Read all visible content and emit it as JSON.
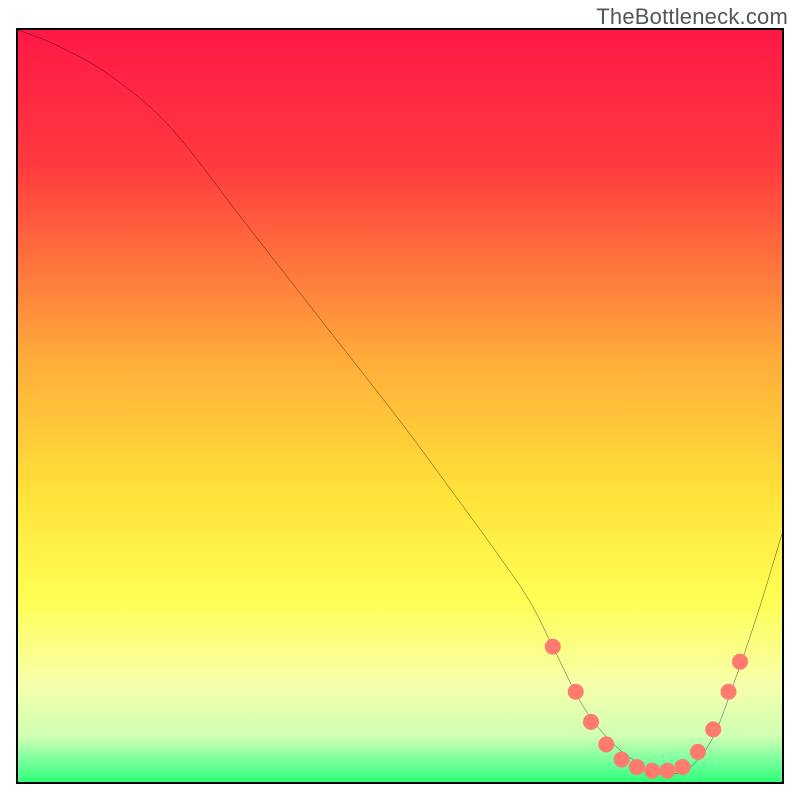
{
  "watermark": "TheBottleneck.com",
  "chart_data": {
    "type": "line",
    "title": "",
    "xlabel": "",
    "ylabel": "",
    "xlim": [
      0,
      100
    ],
    "ylim": [
      0,
      100
    ],
    "gradient_stops": [
      {
        "offset": 0,
        "color": "#ff1846"
      },
      {
        "offset": 18,
        "color": "#ff3a3f"
      },
      {
        "offset": 45,
        "color": "#ffb13a"
      },
      {
        "offset": 62,
        "color": "#ffe33a"
      },
      {
        "offset": 76,
        "color": "#ffff55"
      },
      {
        "offset": 87,
        "color": "#f6ffab"
      },
      {
        "offset": 94,
        "color": "#cfffb4"
      },
      {
        "offset": 97,
        "color": "#7dffa0"
      },
      {
        "offset": 100,
        "color": "#2dff78"
      }
    ],
    "series": [
      {
        "name": "curve",
        "color": "#000000",
        "x": [
          0,
          5,
          12,
          20,
          30,
          40,
          50,
          58,
          63,
          67,
          70,
          74,
          78,
          82,
          85,
          88,
          91,
          94,
          97,
          100
        ],
        "y": [
          100,
          98,
          94,
          87,
          74,
          61,
          48,
          37,
          30,
          24,
          18,
          10,
          5,
          2,
          1,
          2,
          6,
          14,
          23,
          33
        ]
      }
    ],
    "markers": {
      "name": "dots",
      "color": "#ff7b6f",
      "radius": 8,
      "points": [
        {
          "x": 70,
          "y": 18
        },
        {
          "x": 73,
          "y": 12
        },
        {
          "x": 75,
          "y": 8
        },
        {
          "x": 77,
          "y": 5
        },
        {
          "x": 79,
          "y": 3
        },
        {
          "x": 81,
          "y": 2
        },
        {
          "x": 83,
          "y": 1.5
        },
        {
          "x": 85,
          "y": 1.5
        },
        {
          "x": 87,
          "y": 2
        },
        {
          "x": 89,
          "y": 4
        },
        {
          "x": 91,
          "y": 7
        },
        {
          "x": 93,
          "y": 12
        },
        {
          "x": 94.5,
          "y": 16
        }
      ]
    }
  }
}
